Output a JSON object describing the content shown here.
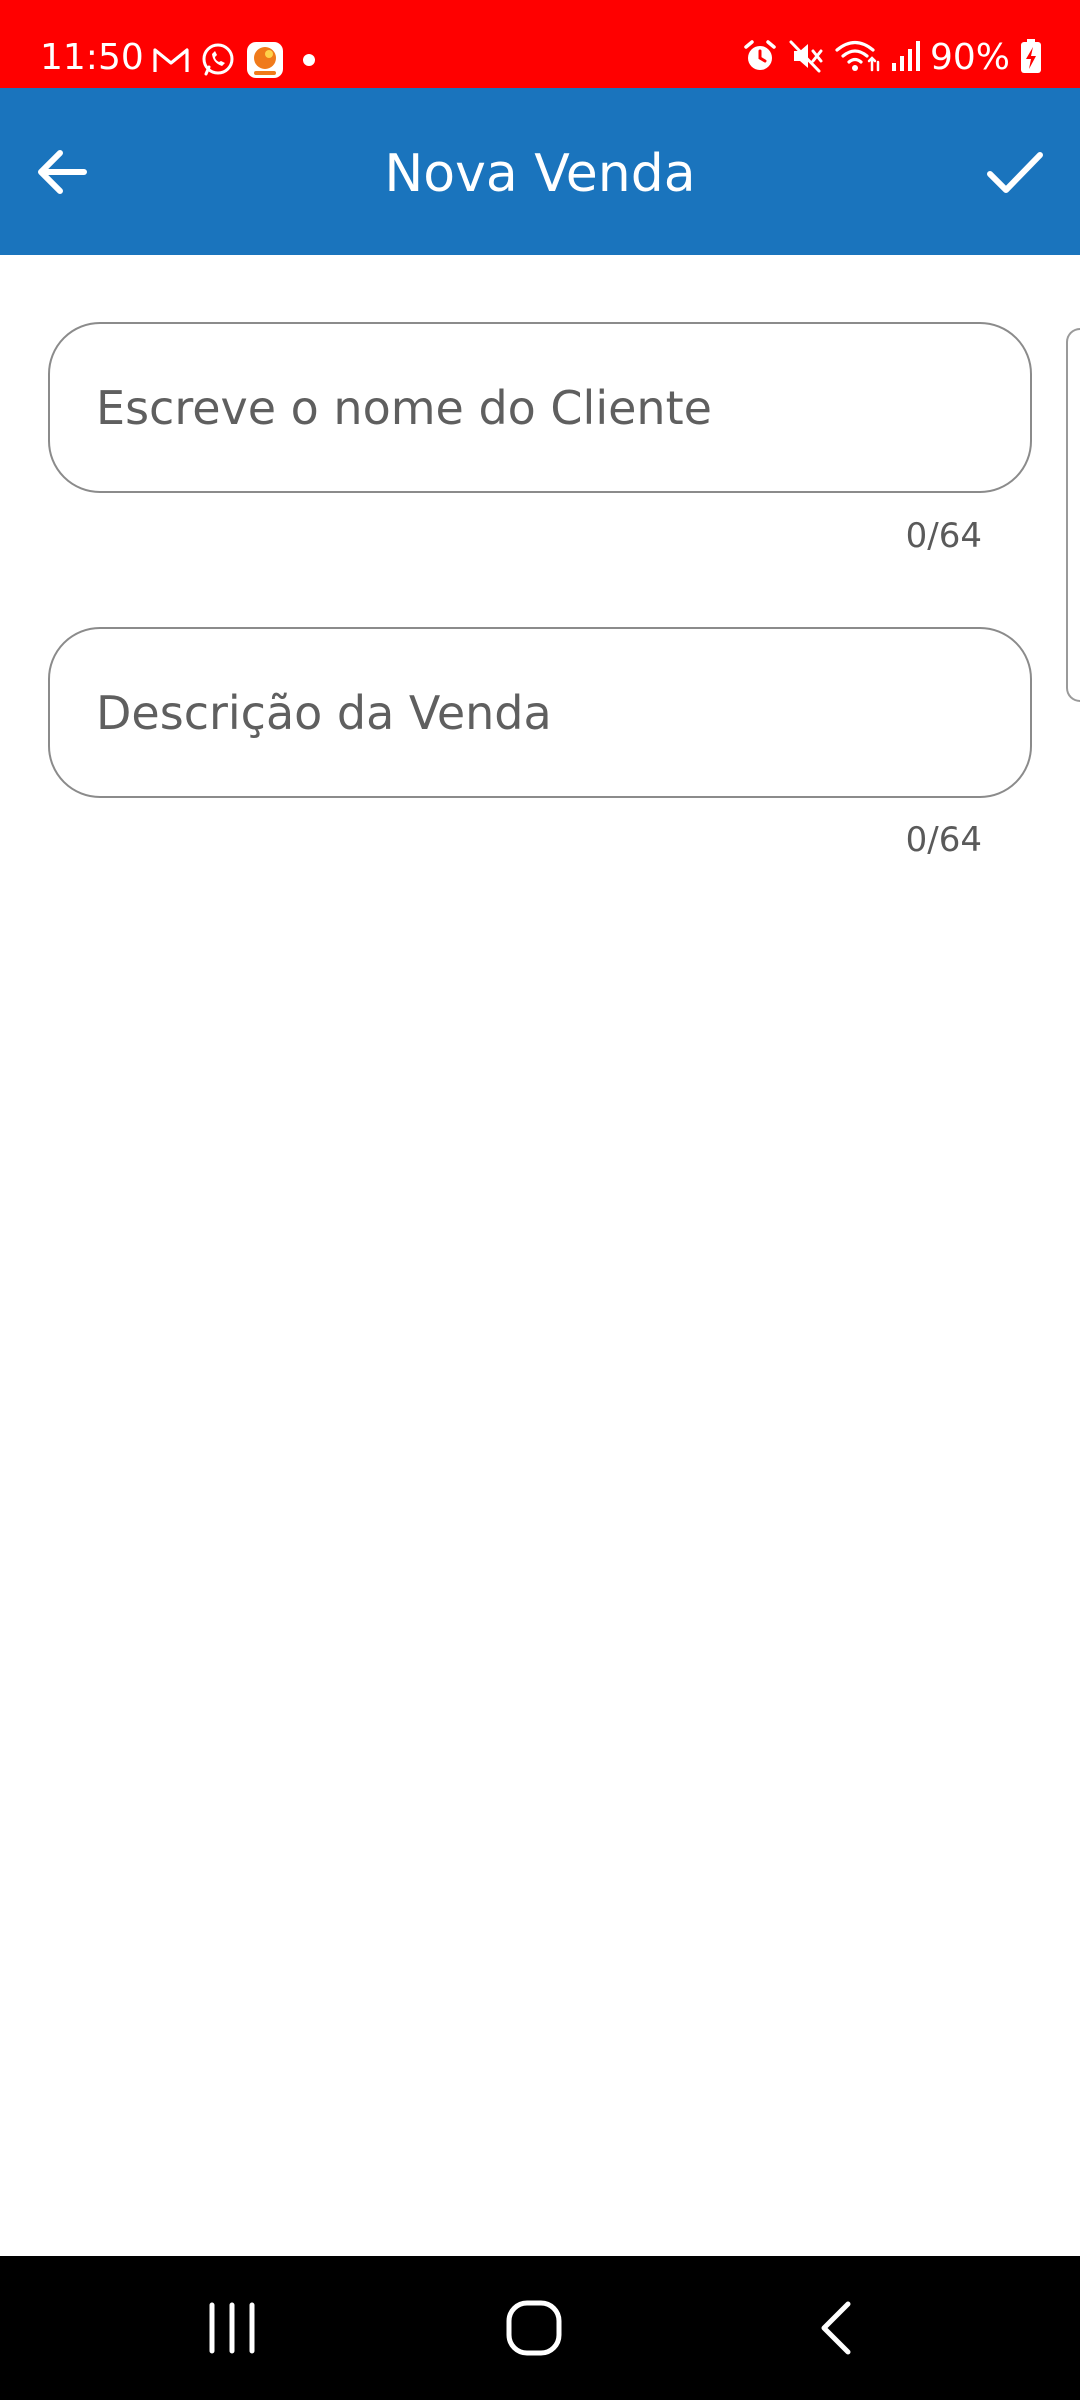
{
  "status_bar": {
    "time": "11:50",
    "battery": "90%",
    "background_color": "#ff0000",
    "left_icons": [
      "gmail-icon",
      "whatsapp-icon",
      "app-notification-icon",
      "dot-icon"
    ],
    "right_icons": [
      "alarm-icon",
      "mute-icon",
      "wifi-icon",
      "signal-icon",
      "battery-charging-icon"
    ]
  },
  "app_bar": {
    "title": "Nova Venda",
    "background_color": "#1a74bd",
    "back_icon": "arrow-left-icon",
    "confirm_icon": "check-icon"
  },
  "form": {
    "client_name": {
      "value": "",
      "placeholder": "Escreve o nome do Cliente",
      "counter": "0/64"
    },
    "description": {
      "value": "",
      "placeholder": "Descrição da Venda",
      "counter": "0/64"
    }
  },
  "nav_bar": {
    "buttons": [
      "recents-icon",
      "home-icon",
      "back-icon"
    ]
  }
}
